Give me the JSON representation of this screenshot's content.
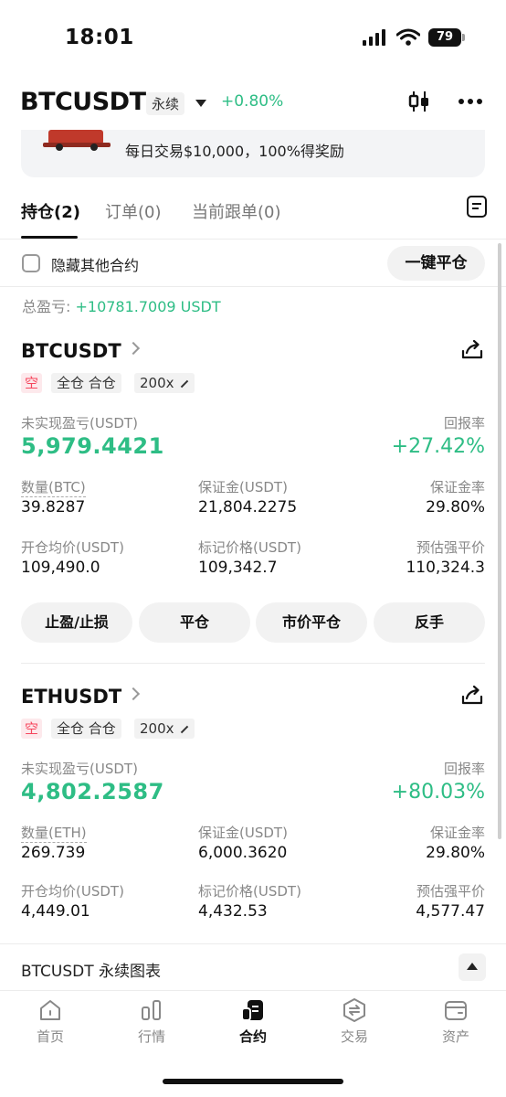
{
  "status": {
    "time": "18:01",
    "battery": "79"
  },
  "header": {
    "symbol": "BTCUSDT",
    "contract_type": "永续",
    "change": "+0.80%"
  },
  "banner": {
    "text": "每日交易$10,000，100%得奖励"
  },
  "tabs": [
    {
      "label": "持仓(2)",
      "active": true
    },
    {
      "label": "订单(0)",
      "active": false
    },
    {
      "label": "当前跟单(0)",
      "active": false
    }
  ],
  "filter": {
    "hide_label": "隐藏其他合约",
    "close_all": "一键平仓"
  },
  "total": {
    "label": "总盈亏: ",
    "value": "+10781.7009 USDT"
  },
  "positions": [
    {
      "symbol": "BTCUSDT",
      "side": "空",
      "mode": "全仓 合仓",
      "leverage": "200x",
      "upnl_label": "未实现盈亏(USDT)",
      "upnl": "5,979.4421",
      "roe_label": "回报率",
      "roe": "+27.42%",
      "qty_label": "数量(BTC)",
      "qty": "39.8287",
      "margin_label": "保证金(USDT)",
      "margin": "21,804.2275",
      "margin_ratio_label": "保证金率",
      "margin_ratio": "29.80%",
      "entry_label": "开仓均价(USDT)",
      "entry": "109,490.0",
      "mark_label": "标记价格(USDT)",
      "mark": "109,342.7",
      "liq_label": "预估强平价",
      "liq": "110,324.3"
    },
    {
      "symbol": "ETHUSDT",
      "side": "空",
      "mode": "全仓 合仓",
      "leverage": "200x",
      "upnl_label": "未实现盈亏(USDT)",
      "upnl": "4,802.2587",
      "roe_label": "回报率",
      "roe": "+80.03%",
      "qty_label": "数量(ETH)",
      "qty": "269.739",
      "margin_label": "保证金(USDT)",
      "margin": "6,000.3620",
      "margin_ratio_label": "保证金率",
      "margin_ratio": "29.80%",
      "entry_label": "开仓均价(USDT)",
      "entry": "4,449.01",
      "mark_label": "标记价格(USDT)",
      "mark": "4,432.53",
      "liq_label": "预估强平价",
      "liq": "4,577.47"
    }
  ],
  "actions": [
    "止盈/止损",
    "平仓",
    "市价平仓",
    "反手"
  ],
  "chart_bar": {
    "label": "BTCUSDT 永续图表"
  },
  "nav": [
    {
      "label": "首页",
      "icon": "home-icon"
    },
    {
      "label": "行情",
      "icon": "market-icon"
    },
    {
      "label": "合约",
      "icon": "futures-icon",
      "active": true
    },
    {
      "label": "交易",
      "icon": "trade-icon"
    },
    {
      "label": "资产",
      "icon": "wallet-icon"
    }
  ],
  "colors": {
    "green": "#2ebd85",
    "red": "#f6465d"
  }
}
